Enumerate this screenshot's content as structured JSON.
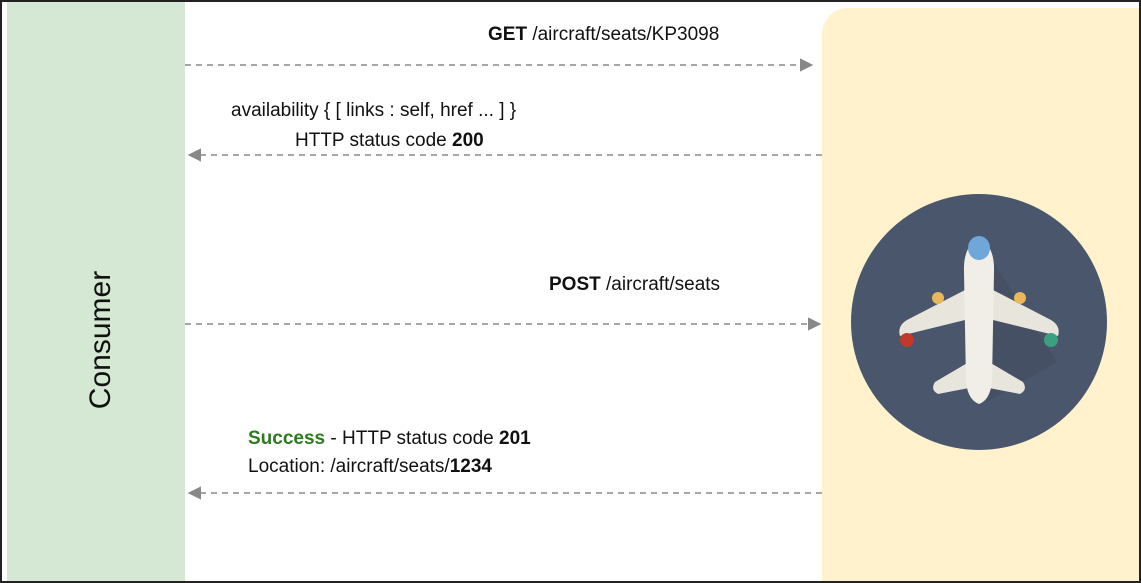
{
  "lanes": {
    "consumer_label": "Consumer"
  },
  "messages": {
    "get_method": "GET",
    "get_path": " /aircraft/seats/KP3098",
    "availability_line": "availability { [ links : self, href ... ] }",
    "status200_prefix": "HTTP status code ",
    "status200_code": "200",
    "post_method": "POST",
    "post_path": " /aircraft/seats",
    "success_word": "Success",
    "status201_prefix": " - HTTP status code ",
    "status201_code": "201",
    "location_prefix": "Location: /aircraft/seats/",
    "location_id": "1234"
  },
  "colors": {
    "consumer_lane": "#d5e8d4",
    "service_lane": "#fff2cc",
    "arrow": "#888888",
    "success": "#2d7a1f",
    "icon_circle": "#4a566c"
  }
}
